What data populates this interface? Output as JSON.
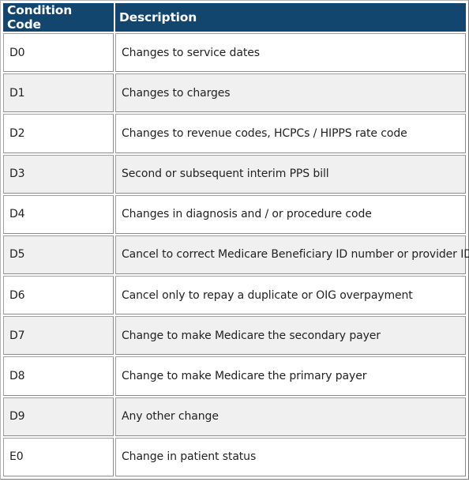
{
  "table": {
    "header_bg": "#13466f",
    "columns": [
      "Condition Code",
      "Description"
    ],
    "rows": [
      {
        "code": "D0",
        "description": "Changes to service dates"
      },
      {
        "code": "D1",
        "description": "Changes to charges"
      },
      {
        "code": "D2",
        "description": "Changes to revenue codes, HCPCs / HIPPS rate code"
      },
      {
        "code": "D3",
        "description": "Second or subsequent interim PPS bill"
      },
      {
        "code": "D4",
        "description": "Changes in diagnosis and / or procedure code"
      },
      {
        "code": "D5",
        "description": "Cancel to correct Medicare Beneficiary ID number or provider ID"
      },
      {
        "code": "D6",
        "description": "Cancel only to repay a duplicate or OIG overpayment"
      },
      {
        "code": "D7",
        "description": "Change to make Medicare the secondary payer"
      },
      {
        "code": "D8",
        "description": "Change to make Medicare the primary payer"
      },
      {
        "code": "D9",
        "description": "Any other change"
      },
      {
        "code": "E0",
        "description": "Change in patient status"
      }
    ]
  }
}
